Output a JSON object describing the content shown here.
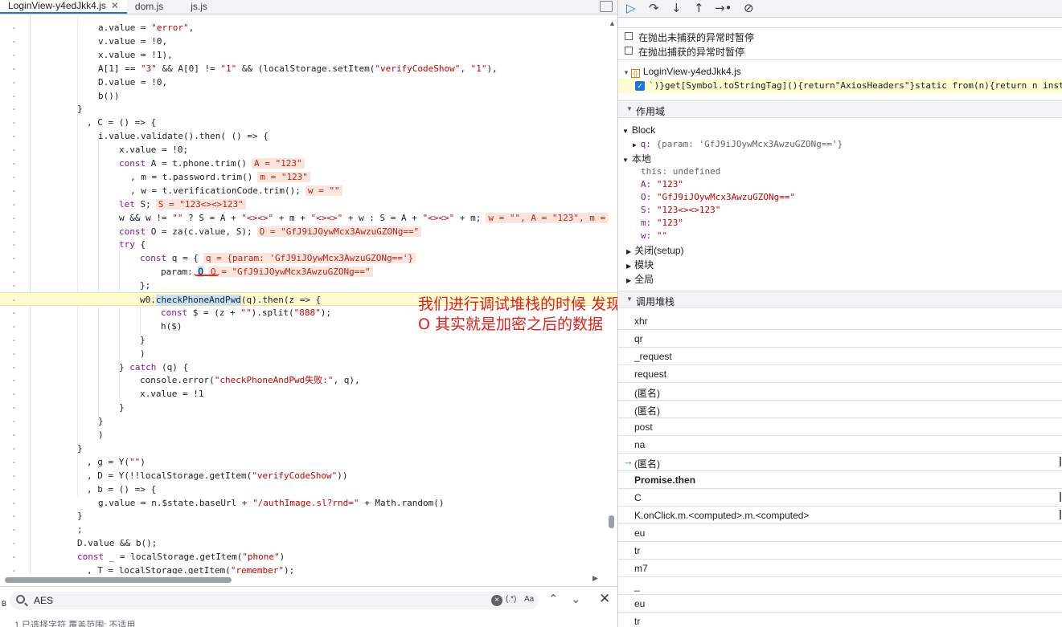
{
  "tabs": [
    {
      "label": "LoginView-y4edJkk4.js",
      "active": true
    },
    {
      "label": "dom.js",
      "active": false
    },
    {
      "label": "js.js",
      "active": false
    }
  ],
  "code": {
    "lines": [
      {
        "g": "-",
        "parts": [
          [
            "p",
            "a.value = "
          ],
          [
            "s",
            "\"error\""
          ],
          [
            "p",
            ","
          ]
        ]
      },
      {
        "g": "-",
        "parts": [
          [
            "p",
            "v.value = "
          ],
          [
            "p",
            "!0,"
          ]
        ]
      },
      {
        "g": "-",
        "parts": [
          [
            "p",
            "x.value = !1),"
          ]
        ]
      },
      {
        "g": "-",
        "parts": [
          [
            "p",
            "A[1] == "
          ],
          [
            "s",
            "\"3\""
          ],
          [
            "p",
            " && A[0] != "
          ],
          [
            "s",
            "\"1\""
          ],
          [
            "p",
            " && (localStorage.setItem("
          ],
          [
            "s",
            "\"verifyCodeShow\""
          ],
          [
            "p",
            ", "
          ],
          [
            "s",
            "\"1\""
          ],
          [
            "p",
            "),"
          ]
        ]
      },
      {
        "g": "-",
        "parts": [
          [
            "p",
            "D.value = !0,"
          ]
        ]
      },
      {
        "g": "-",
        "parts": [
          [
            "p",
            "b())"
          ]
        ]
      },
      {
        "g": "-",
        "parts": [
          [
            "p",
            "}"
          ]
        ]
      },
      {
        "g": "-",
        "parts": [
          [
            "p",
            ", C = () => {"
          ]
        ]
      },
      {
        "g": "-",
        "parts": [
          [
            "p",
            "i.value.validate().then( () => {"
          ]
        ]
      },
      {
        "g": "-",
        "parts": [
          [
            "p",
            "x.value = !0;"
          ]
        ]
      },
      {
        "g": "-",
        "parts": [
          [
            "k",
            "const"
          ],
          [
            "p",
            " A = t.phone.trim()"
          ],
          [
            "v",
            "A = \"123\""
          ]
        ]
      },
      {
        "g": "-",
        "parts": [
          [
            "p",
            ", m = t.password.trim()"
          ],
          [
            "v",
            "m = \"123\""
          ]
        ]
      },
      {
        "g": "-",
        "parts": [
          [
            "p",
            ", w = t.verificationCode.trim();"
          ],
          [
            "v",
            "w = \"\""
          ]
        ]
      },
      {
        "g": "-",
        "parts": [
          [
            "k",
            "let"
          ],
          [
            "p",
            " S;"
          ],
          [
            "v",
            "S = \"123<><>123\""
          ]
        ]
      },
      {
        "g": "-",
        "parts": [
          [
            "p",
            "w && w != "
          ],
          [
            "s",
            "\"\""
          ],
          [
            "p",
            " ? S = A + "
          ],
          [
            "s",
            "\"<><>\""
          ],
          [
            "p",
            " + m + "
          ],
          [
            "s",
            "\"<><>\""
          ],
          [
            "p",
            " + w : S = A + "
          ],
          [
            "s",
            "\"<><>\""
          ],
          [
            "p",
            " + m;"
          ],
          [
            "v",
            "w = \"\", A = \"123\", m ="
          ]
        ]
      },
      {
        "g": "-",
        "parts": [
          [
            "k",
            "const"
          ],
          [
            "p",
            " O = za(c.value, S);"
          ],
          [
            "v",
            "O = \"GfJ9iJOywMcx3AwzuGZONg==\""
          ]
        ]
      },
      {
        "g": "-",
        "parts": [
          [
            "k",
            "try"
          ],
          [
            "p",
            " {"
          ]
        ]
      },
      {
        "g": "-",
        "parts": [
          [
            "k",
            "const"
          ],
          [
            "p",
            " q = {"
          ],
          [
            "v",
            "q = {param: 'GfJ9iJOywMcx3AwzuGZONg=='}"
          ]
        ]
      },
      {
        "g": "-",
        "parts": [
          [
            "p",
            "param: "
          ],
          [
            "c",
            "O"
          ],
          [
            "v",
            "O = \"GfJ9iJOywMcx3AwzuGZONg==\""
          ]
        ]
      },
      {
        "g": "-",
        "parts": [
          [
            "p",
            "};"
          ]
        ]
      },
      {
        "g": "-",
        "parts": [
          [
            "p",
            "w0."
          ],
          [
            "h",
            "checkPhoneAndPwd"
          ],
          [
            "p",
            "(q).then(z => {"
          ]
        ]
      },
      {
        "g": "-",
        "parts": [
          [
            "k",
            "const"
          ],
          [
            "p",
            " $ = (z + "
          ],
          [
            "s",
            "\"\""
          ],
          [
            "p",
            ").split("
          ],
          [
            "s",
            "\"888\""
          ],
          [
            "p",
            ");"
          ]
        ]
      },
      {
        "g": "-",
        "parts": [
          [
            "p",
            "h($)"
          ]
        ]
      },
      {
        "g": "-",
        "parts": [
          [
            "p",
            "}"
          ]
        ]
      },
      {
        "g": "-",
        "parts": [
          [
            "p",
            ")"
          ]
        ]
      },
      {
        "g": "-",
        "parts": [
          [
            "p",
            "} "
          ],
          [
            "k",
            "catch"
          ],
          [
            "p",
            " (q) {"
          ]
        ]
      },
      {
        "g": "-",
        "parts": [
          [
            "p",
            "console.error("
          ],
          [
            "s",
            "\"checkPhoneAndPwd失败:\""
          ],
          [
            "p",
            ", q),"
          ]
        ]
      },
      {
        "g": "-",
        "parts": [
          [
            "p",
            "x.value = !1"
          ]
        ]
      },
      {
        "g": "-",
        "parts": [
          [
            "p",
            "}"
          ]
        ]
      },
      {
        "g": "-",
        "parts": [
          [
            "p",
            "}"
          ]
        ]
      },
      {
        "g": "-",
        "parts": [
          [
            "p",
            ")"
          ]
        ]
      },
      {
        "g": "-",
        "parts": [
          [
            "p",
            "}"
          ]
        ]
      },
      {
        "g": "-",
        "parts": [
          [
            "p",
            ", g = Y("
          ],
          [
            "s",
            "\"\""
          ],
          [
            "p",
            ")"
          ]
        ]
      },
      {
        "g": "-",
        "parts": [
          [
            "p",
            ", D = Y(!!localStorage.getItem("
          ],
          [
            "s",
            "\"verifyCodeShow\""
          ],
          [
            "p",
            "))"
          ]
        ]
      },
      {
        "g": "-",
        "parts": [
          [
            "p",
            ", b = () => {"
          ]
        ]
      },
      {
        "g": "-",
        "parts": [
          [
            "p",
            "g.value = n.$state.baseUrl + "
          ],
          [
            "s",
            "\"/authImage.sl?rnd=\""
          ],
          [
            "p",
            " + Math.random()"
          ]
        ]
      },
      {
        "g": "-",
        "parts": [
          [
            "p",
            "}"
          ]
        ]
      },
      {
        "g": "-",
        "parts": [
          [
            "p",
            ";"
          ]
        ]
      },
      {
        "g": "-",
        "parts": [
          [
            "p",
            "D.value && b();"
          ]
        ]
      },
      {
        "g": "-",
        "parts": [
          [
            "k",
            "const"
          ],
          [
            "p",
            " _ = localStorage.getItem("
          ],
          [
            "s",
            "\"phone\""
          ],
          [
            "p",
            ")"
          ]
        ]
      },
      {
        "g": "-",
        "parts": [
          [
            "p",
            ", T = localStorage.getItem("
          ],
          [
            "s",
            "\"remember\""
          ],
          [
            "p",
            ");"
          ]
        ]
      }
    ]
  },
  "annotation": {
    "line1": "我们进行调试堆栈的时候 发现参数",
    "line2": "O  其实就是加密之后的数据"
  },
  "search": {
    "value": "AES",
    "regex_label": "(.*)",
    "case_label": "Aa",
    "side_label": "B"
  },
  "status": {
    "text": "1 已选择字符    覆盖范围: 不适用"
  },
  "right": {
    "pause_uncaught": "在抛出未捕获的异常时暂停",
    "pause_caught": "在抛出捕获的异常时暂停",
    "bp_file": "LoginView-y4edJkk4.js",
    "bp_code": "`)}get[Symbol.toStringTag](){return\"AxiosHeaders\"}static from(n){return n inst",
    "scope_title": "作用域",
    "block_label": "Block",
    "block_q_key": "q:",
    "block_q_val": "{param: 'GfJ9iJOywMcx3AwzuGZONg=='}",
    "local_label": "本地",
    "locals": [
      {
        "key": "this:",
        "val": "undefined",
        "gray": true
      },
      {
        "key": "A:",
        "val": "\"123\""
      },
      {
        "key": "O:",
        "val": "\"GfJ9iJOywMcx3AwzuGZONg==\""
      },
      {
        "key": "S:",
        "val": "\"123<><>123\""
      },
      {
        "key": "m:",
        "val": "\"123\""
      },
      {
        "key": "w:",
        "val": "\"\""
      }
    ],
    "closure_label": "关闭(setup)",
    "module_label": "模块",
    "global_label": "全局",
    "callstack_title": "调用堆栈",
    "frames": [
      {
        "label": "xhr"
      },
      {
        "label": "qr"
      },
      {
        "label": "_request"
      },
      {
        "label": "request"
      },
      {
        "label": "(匿名)"
      },
      {
        "label": "(匿名)"
      },
      {
        "label": "post"
      },
      {
        "label": "na"
      },
      {
        "label": "(匿名)",
        "current": true
      },
      {
        "label": "Promise.then",
        "async": true
      },
      {
        "label": "C"
      },
      {
        "label": "K.onClick.m.<computed>.m.<computed>"
      },
      {
        "label": "eu"
      },
      {
        "label": "tr"
      },
      {
        "label": "m7"
      },
      {
        "label": "_"
      },
      {
        "label": "eu"
      },
      {
        "label": "tr"
      }
    ]
  },
  "colors": {
    "accent": "#1a73e8",
    "annotation": "#e0201b",
    "highlight": "#fffbd0"
  }
}
